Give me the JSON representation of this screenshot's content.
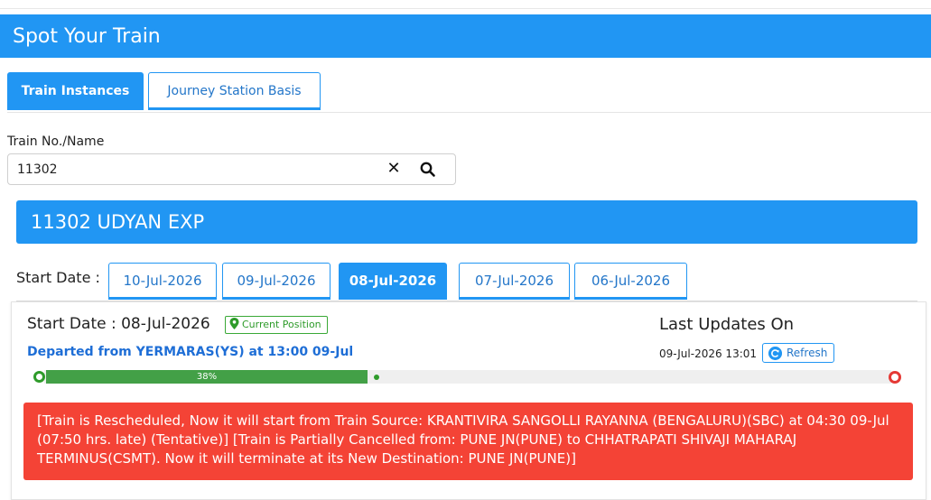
{
  "header": {
    "title": "Spot Your Train"
  },
  "tabs": {
    "active": "Train Instances",
    "inactive": "Journey Station Basis"
  },
  "search": {
    "label": "Train No./Name",
    "value": "11302"
  },
  "train": {
    "title": "11302 UDYAN EXP"
  },
  "dates": {
    "label": "Start Date :",
    "items": [
      "10-Jul-2026",
      "09-Jul-2026",
      "08-Jul-2026",
      "07-Jul-2026",
      "06-Jul-2026"
    ],
    "selected": "08-Jul-2026"
  },
  "status": {
    "start_date": "Start Date : 08-Jul-2026",
    "current_position_label": "Current Position",
    "last_updates_label": "Last Updates On",
    "departed": "Departed from YERMARAS(YS) at 13:00 09-Jul",
    "update_time": "09-Jul-2026 13:01",
    "refresh_label": "Refresh",
    "progress_percent": 38,
    "progress_label": "38%",
    "alert": "[Train is Rescheduled, Now it will start from Train Source: KRANTIVIRA SANGOLLI RAYANNA (BENGALURU)(SBC) at 04:30 09-Jul (07:50 hrs. late) (Tentative)] [Train is Partially Cancelled from: PUNE JN(PUNE) to CHHATRAPATI SHIVAJI MAHARAJ TERMINUS(CSMT). Now it will terminate at its New Destination: PUNE JN(PUNE)]"
  },
  "icons": {
    "clear": "close-icon",
    "search": "search-icon",
    "pin": "location-pin-icon",
    "refresh": "refresh-icon"
  },
  "colors": {
    "primary": "#2196f3",
    "progress": "#43a047",
    "alert": "#f44336",
    "start_point": "#2e9b2a",
    "end_point": "#e53935"
  }
}
